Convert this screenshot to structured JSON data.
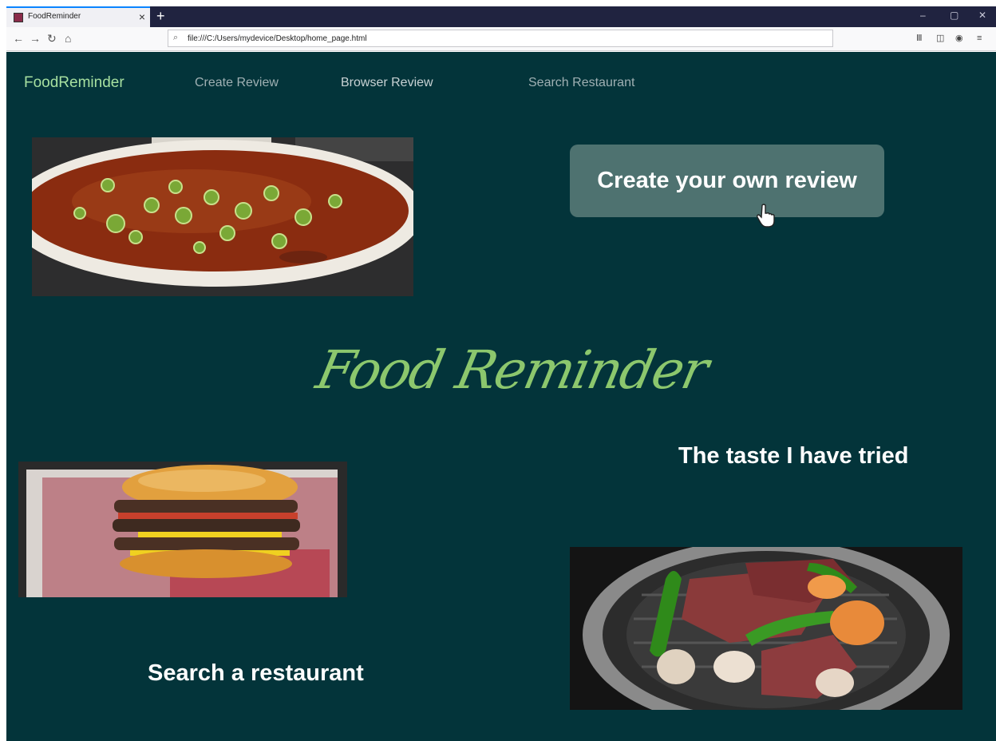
{
  "browser": {
    "tab_title": "FoodReminder",
    "tab_close": "×",
    "new_tab": "+",
    "url": "file:///C:/Users/mydevice/Desktop/home_page.html",
    "window_controls": [
      "–",
      "▢",
      "✕"
    ]
  },
  "nav": {
    "brand": "FoodReminder",
    "links": [
      "Create Review",
      "Browser Review",
      "Search Restaurant"
    ]
  },
  "hero": {
    "create_button": "Create your own review",
    "script_title": "Food Reminder",
    "tagline": "The taste I have tried",
    "search_cta": "Search a restaurant"
  },
  "images": {
    "soup": "pho-soup-photo",
    "burger": "burger-photo",
    "grill": "korean-bbq-grill-photo"
  },
  "colors": {
    "page_bg": "#03343a",
    "brand": "#a7e0a0",
    "button_bg": "#4e7270",
    "script_title": "#8cc76d"
  }
}
